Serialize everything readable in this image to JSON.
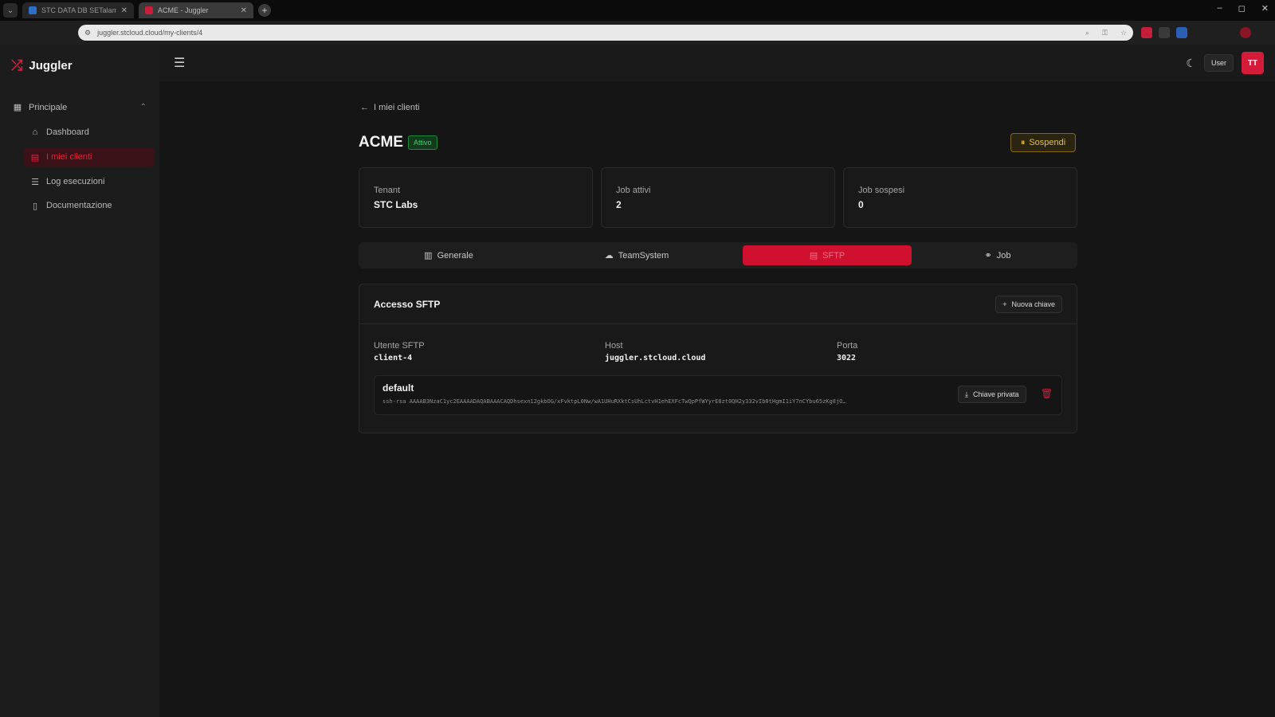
{
  "browser": {
    "tabs": [
      {
        "title": "STC DATA DB SETalamble D"
      },
      {
        "title": "ACME - Juggler"
      }
    ],
    "url": "juggler.stcloud.cloud/my-clients/4",
    "window_controls": [
      "–",
      "◻",
      "✕"
    ]
  },
  "app": {
    "name": "Juggler",
    "accent": "#d51b3a"
  },
  "sidebar": {
    "section": "Principale",
    "items": [
      {
        "label": "Dashboard",
        "icon": "home-icon"
      },
      {
        "label": "I miei clienti",
        "icon": "clients-icon",
        "active": true
      },
      {
        "label": "Log esecuzioni",
        "icon": "log-icon"
      },
      {
        "label": "Documentazione",
        "icon": "book-icon"
      }
    ]
  },
  "header": {
    "user_label": "User",
    "avatar_initials": "TT"
  },
  "main": {
    "back_label": "I miei clienti",
    "client_name": "ACME",
    "status_badge": "Attivo",
    "suspend_label": "Sospendi",
    "cards": [
      {
        "label": "Tenant",
        "value": "STC Labs"
      },
      {
        "label": "Job attivi",
        "value": "2"
      },
      {
        "label": "Job sospesi",
        "value": "0"
      }
    ],
    "tabs": [
      {
        "label": "Generale",
        "icon": "building-icon"
      },
      {
        "label": "TeamSystem",
        "icon": "cloud-icon"
      },
      {
        "label": "SFTP",
        "icon": "server-icon",
        "active": true
      },
      {
        "label": "Job",
        "icon": "link-icon"
      }
    ]
  },
  "sftp": {
    "title": "Accesso SFTP",
    "new_key_label": "Nuova chiave",
    "user_label": "Utente SFTP",
    "user_value": "client-4",
    "host_label": "Host",
    "host_value": "juggler.stcloud.cloud",
    "port_label": "Porta",
    "port_value": "3022",
    "key": {
      "name": "default",
      "value": "ssh-rsa AAAAB3NzaC1yc2EAAAADAQABAAACAQDhsexn12gkbOG/xFvktpL0Nw/wA1UHuRXktCsUhLctvH1ehEXFcTwQpPfWYyrE8zt0QH2y332vIb0tHgmI1iY7nCYbu65zKg8jO…",
      "private_label": "Chiave privata"
    }
  }
}
